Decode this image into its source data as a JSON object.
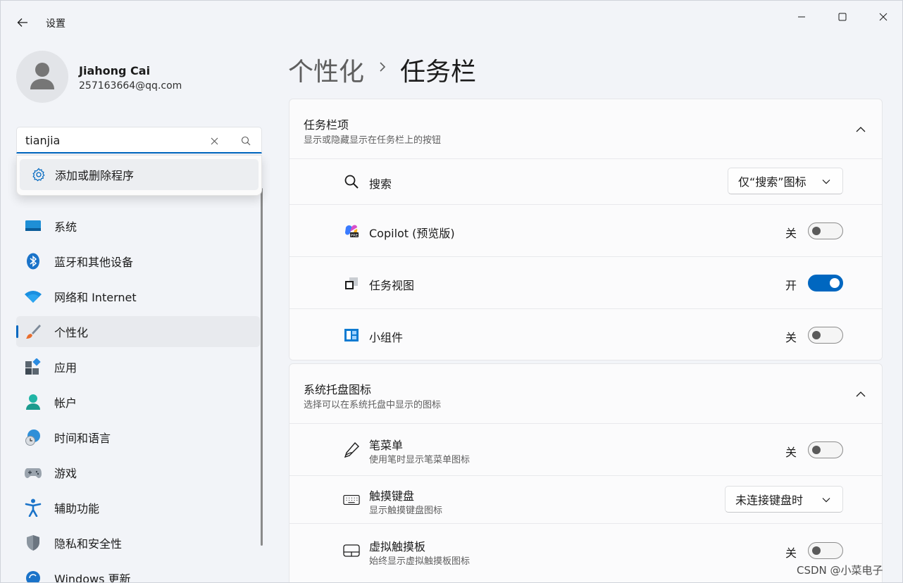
{
  "window": {
    "title": "设置"
  },
  "profile": {
    "name": "Jiahong Cai",
    "email": "257163664@qq.com"
  },
  "search": {
    "value": "tianjia",
    "suggestion": "添加或删除程序"
  },
  "nav": {
    "items": [
      {
        "label": "系统",
        "icon": "system-icon"
      },
      {
        "label": "蓝牙和其他设备",
        "icon": "bluetooth-icon"
      },
      {
        "label": "网络和 Internet",
        "icon": "wifi-icon"
      },
      {
        "label": "个性化",
        "icon": "brush-icon",
        "active": true
      },
      {
        "label": "应用",
        "icon": "apps-icon"
      },
      {
        "label": "帐户",
        "icon": "account-icon"
      },
      {
        "label": "时间和语言",
        "icon": "globe-clock-icon"
      },
      {
        "label": "游戏",
        "icon": "gamepad-icon"
      },
      {
        "label": "辅助功能",
        "icon": "accessibility-icon"
      },
      {
        "label": "隐私和安全性",
        "icon": "shield-icon"
      },
      {
        "label": "Windows 更新",
        "icon": "update-icon"
      }
    ]
  },
  "header": {
    "parent": "个性化",
    "current": "任务栏"
  },
  "taskbar_items": {
    "title": "任务栏项",
    "subtitle": "显示或隐藏显示在任务栏上的按钮",
    "rows": [
      {
        "label": "搜索",
        "control": "dropdown",
        "value": "仅“搜索”图标"
      },
      {
        "label": "Copilot (预览版)",
        "control": "toggle",
        "state": "关",
        "on": false
      },
      {
        "label": "任务视图",
        "control": "toggle",
        "state": "开",
        "on": true
      },
      {
        "label": "小组件",
        "control": "toggle",
        "state": "关",
        "on": false
      }
    ]
  },
  "tray_icons": {
    "title": "系统托盘图标",
    "subtitle": "选择可以在系统托盘中显示的图标",
    "rows": [
      {
        "label": "笔菜单",
        "sub": "使用笔时显示笔菜单图标",
        "control": "toggle",
        "state": "关",
        "on": false
      },
      {
        "label": "触摸键盘",
        "sub": "显示触摸键盘图标",
        "control": "dropdown",
        "value": "未连接键盘时"
      },
      {
        "label": "虚拟触摸板",
        "sub": "始终显示虚拟触摸板图标",
        "control": "toggle",
        "state": "关",
        "on": false
      }
    ]
  },
  "watermark": "CSDN @小菜电子",
  "colors": {
    "accent": "#0067c0",
    "background": "#f2f4f8",
    "card": "#fbfbfc"
  }
}
